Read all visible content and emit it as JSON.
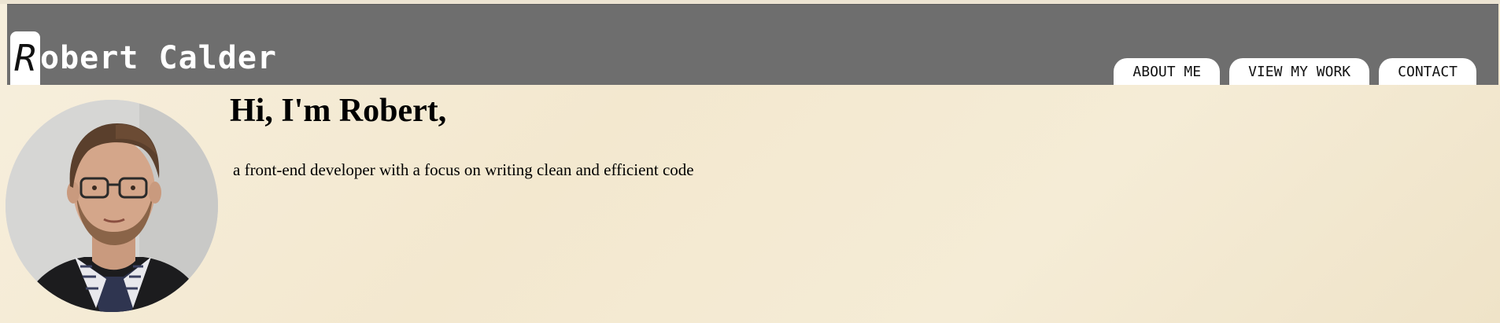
{
  "header": {
    "logo_initial": "R",
    "logo_rest": "obert Calder",
    "background_color": "#6e6e6e"
  },
  "nav": {
    "items": [
      {
        "label": "ABOUT ME"
      },
      {
        "label": "VIEW MY WORK"
      },
      {
        "label": "CONTACT"
      }
    ]
  },
  "hero": {
    "title": "Hi, I'm Robert,",
    "subtitle": "a front-end developer with a focus on writing clean and efficient code",
    "avatar_icon": "profile-photo"
  }
}
